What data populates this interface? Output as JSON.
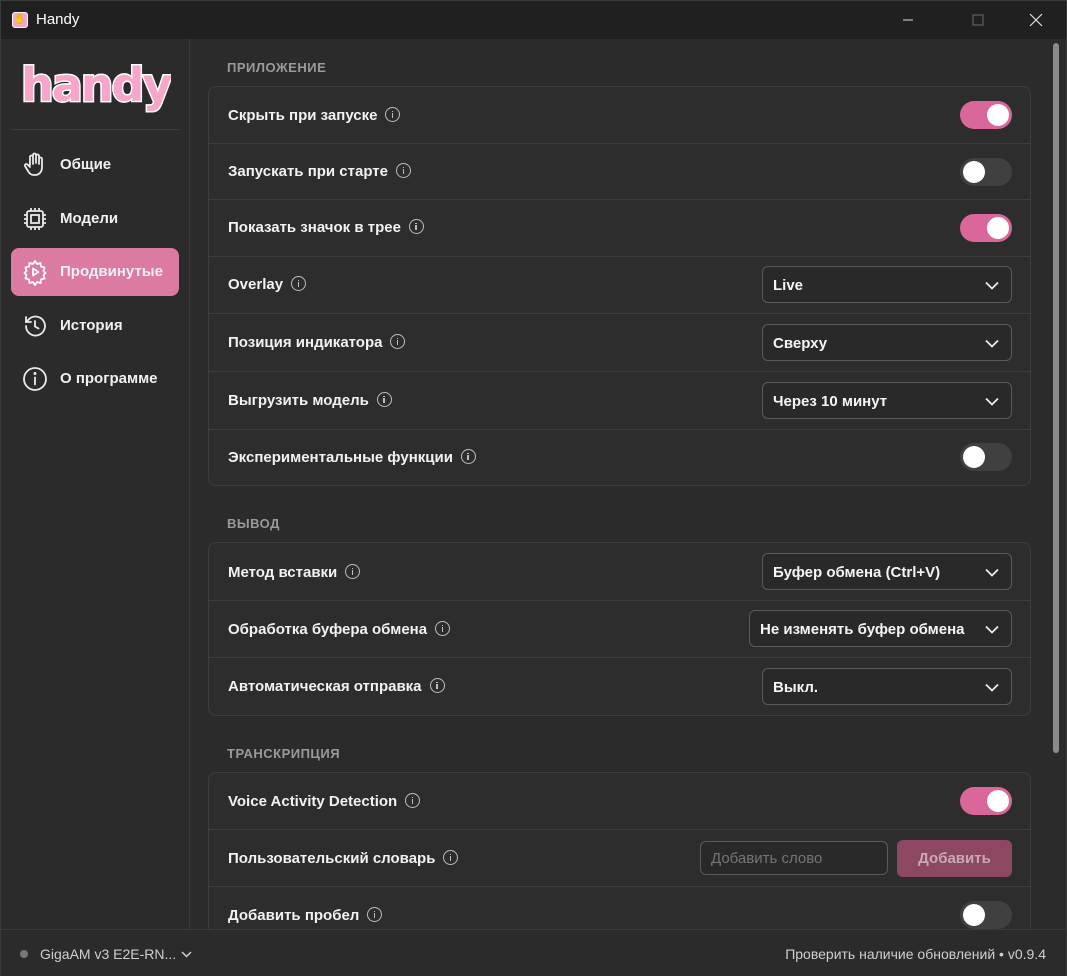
{
  "window": {
    "title": "Handy"
  },
  "sidebar": {
    "logo_text": "handy",
    "items": [
      {
        "label": "Общие",
        "icon": "hand-icon",
        "active": false
      },
      {
        "label": "Модели",
        "icon": "chip-icon",
        "active": false
      },
      {
        "label": "Продвинутые",
        "icon": "gear-play-icon",
        "active": true
      },
      {
        "label": "История",
        "icon": "history-icon",
        "active": false
      },
      {
        "label": "О программе",
        "icon": "info-circle-icon",
        "active": false
      }
    ]
  },
  "sections": {
    "app": {
      "title": "ПРИЛОЖЕНИЕ",
      "rows": {
        "hide_on_launch": {
          "label": "Скрыть при запуске",
          "value": true
        },
        "autostart": {
          "label": "Запускать при старте",
          "value": false
        },
        "tray_icon": {
          "label": "Показать значок в трее",
          "value": true
        },
        "overlay": {
          "label": "Overlay",
          "value": "Live"
        },
        "indicator_position": {
          "label": "Позиция индикатора",
          "value": "Сверху"
        },
        "unload_model": {
          "label": "Выгрузить модель",
          "value": "Через 10 минут"
        },
        "experimental": {
          "label": "Экспериментальные функции",
          "value": false
        }
      }
    },
    "output": {
      "title": "ВЫВОД",
      "rows": {
        "paste_method": {
          "label": "Метод вставки",
          "value": "Буфер обмена (Ctrl+V)"
        },
        "clipboard_handling": {
          "label": "Обработка буфера обмена",
          "value": "Не изменять буфер обмена"
        },
        "auto_send": {
          "label": "Автоматическая отправка",
          "value": "Выкл."
        }
      }
    },
    "transcription": {
      "title": "ТРАНСКРИПЦИЯ",
      "rows": {
        "vad": {
          "label": "Voice Activity Detection",
          "value": true
        },
        "dictionary": {
          "label": "Пользовательский словарь",
          "placeholder": "Добавить слово",
          "button": "Добавить"
        },
        "add_space": {
          "label": "Добавить пробел",
          "value": false
        }
      }
    }
  },
  "footer": {
    "model": "GigaAM v3 E2E-RN...",
    "update_text": "Проверить наличие обновлений • v0.9.4"
  },
  "colors": {
    "accent": "#dc7ba2",
    "toggle_on": "#d9679a",
    "background": "#2c2b2b"
  }
}
